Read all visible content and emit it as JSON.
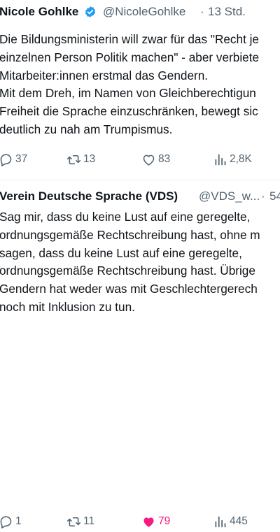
{
  "tweets": [
    {
      "author_name": "Nicole Gohlke",
      "verified": true,
      "handle": "@NicoleGohlke",
      "separator": "·",
      "time": "13 Std.",
      "lines": [
        "Die Bildungsministerin will zwar für das \"Recht je",
        "einzelnen Person Politik machen\" - aber verbiete",
        "Mitarbeiter:innen erstmal das Gendern.",
        "Mit dem Dreh, im Namen von Gleichberechtigun",
        "Freiheit die Sprache einzuschränken, bewegt sic",
        "deutlich zu nah am Trumpismus."
      ],
      "stats": {
        "replies": "37",
        "reposts": "13",
        "likes": "83",
        "views": "2,8K"
      }
    },
    {
      "author_name": "Verein Deutsche Sprache (VDS)",
      "verified": false,
      "handle": "@VDS_w...",
      "separator": "·",
      "time": "54",
      "lines": [
        "Sag mir, dass du keine Lust auf eine geregelte,",
        "ordnungsgemäße Rechtschreibung hast, ohne m",
        "sagen, dass du keine Lust auf eine geregelte,",
        "ordnungsgemäße Rechtschreibung hast. Übrige",
        "Gendern hat weder was mit Geschlechtergerech",
        "noch mit Inklusion zu tun."
      ],
      "stats": {
        "replies": "1",
        "reposts": "11",
        "likes": "79",
        "views": "445"
      },
      "liked": true
    }
  ],
  "colors": {
    "text": "#0f1419",
    "muted": "#536471",
    "verified": "#1d9bf0",
    "like_active": "#f91880"
  },
  "icons": {
    "reply": "reply-icon",
    "repost": "repost-icon",
    "like": "heart-icon",
    "views": "views-icon",
    "verified": "verified-badge-icon"
  }
}
